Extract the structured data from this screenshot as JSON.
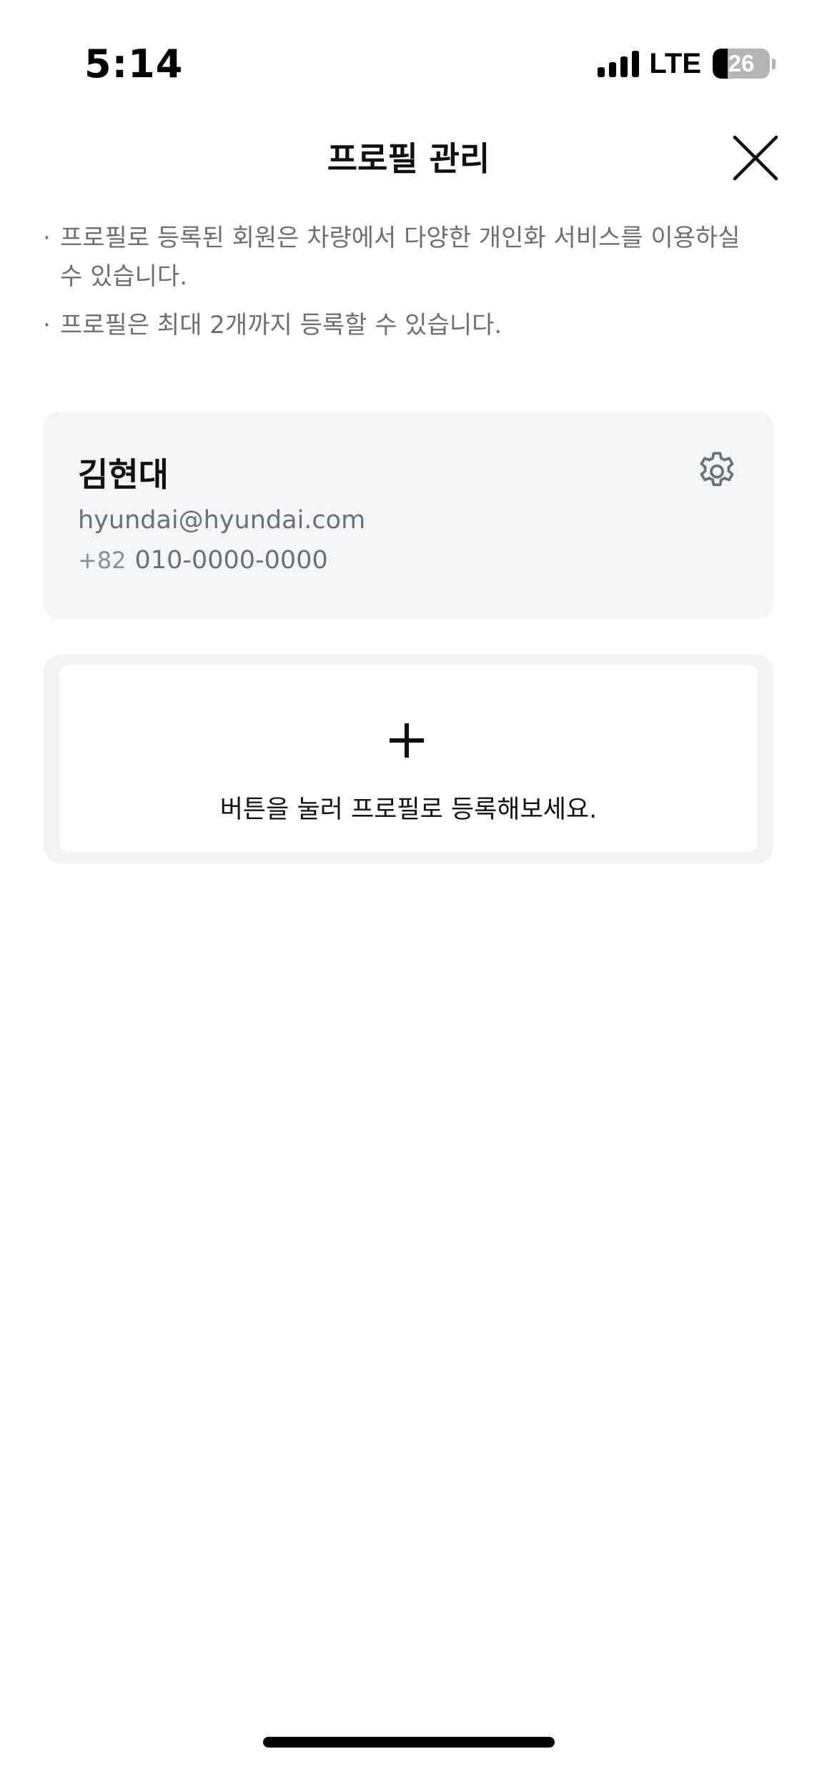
{
  "status_bar": {
    "time": "5:14",
    "network": "LTE",
    "battery_percent": "26",
    "battery_level": 0.26,
    "signal_bars": 4
  },
  "header": {
    "title": "프로필 관리",
    "close_icon": "close-icon"
  },
  "notices": [
    "프로필로 등록된 회원은 차량에서 다양한 개인화 서비스를 이용하실 수 있습니다.",
    "프로필은 최대 2개까지 등록할 수 있습니다."
  ],
  "notice_bullet": "·",
  "profile": {
    "name": "김현대",
    "email": "hyundai@hyundai.com",
    "country_code": "+82",
    "phone": "010-0000-0000",
    "settings_icon": "gear-icon"
  },
  "add_profile": {
    "icon": "plus-icon",
    "label": "버튼을 눌러 프로필로 등록해보세요."
  },
  "colors": {
    "card_background": "#f4f5f7",
    "secondary_text": "#6b6f78",
    "primary_text": "#111111"
  }
}
